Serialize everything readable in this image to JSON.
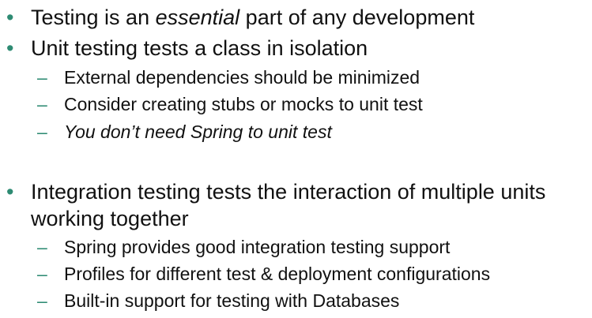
{
  "bullets": {
    "level1_marker": "•",
    "level2_marker": "–",
    "level1_color": "#2e8b73",
    "level2_color": "#2e8b73"
  },
  "items": [
    {
      "pre": "Testing is an ",
      "em": "essential",
      "post": " part of any development"
    },
    {
      "text": "Unit testing tests a class in isolation",
      "subitems": [
        "External dependencies should be minimized",
        "Consider creating stubs or mocks to unit test",
        "You don’t need Spring to unit test"
      ]
    },
    {
      "line1": "Integration testing tests the interaction of multiple units",
      "line2": "working together",
      "subitems": [
        "Spring provides good integration testing support",
        "Profiles for different test & deployment configurations",
        "Built-in support for testing with Databases"
      ]
    }
  ]
}
